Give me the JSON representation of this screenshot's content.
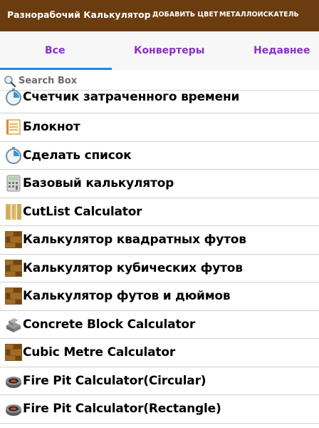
{
  "appbar": {
    "title": "Разнорабочий Калькулятор",
    "actions": [
      "ДОБАВИТЬ ЦВЕТ",
      "МЕТАЛЛОИСКАТЕЛЬ"
    ]
  },
  "tabs": [
    {
      "label": "Все",
      "selected": true
    },
    {
      "label": "Конвертеры",
      "selected": false
    },
    {
      "label": "Недавнее",
      "selected": false
    }
  ],
  "search": {
    "placeholder": "Search Box",
    "icon": "search-icon"
  },
  "items": [
    {
      "label": "Счетчик затраченного времени",
      "icon": "stopwatch-icon"
    },
    {
      "label": "Блокнот",
      "icon": "notepad-icon"
    },
    {
      "label": "Сделать список",
      "icon": "stopwatch-icon"
    },
    {
      "label": "Базовый калькулятор",
      "icon": "calculator-icon"
    },
    {
      "label": "CutList Calculator",
      "icon": "wood-planks-icon"
    },
    {
      "label": "Калькулятор квадратных футов",
      "icon": "wood-floor-icon"
    },
    {
      "label": "Калькулятор кубических футов",
      "icon": "wood-floor-icon"
    },
    {
      "label": "Калькулятор футов и дюймов",
      "icon": "wood-floor-icon"
    },
    {
      "label": "Concrete Block Calculator",
      "icon": "concrete-block-icon"
    },
    {
      "label": "Cubic Metre Calculator",
      "icon": "wood-floor-icon"
    },
    {
      "label": "Fire Pit Calculator(Circular)",
      "icon": "fire-pit-icon"
    },
    {
      "label": "Fire Pit Calculator(Rectangle)",
      "icon": "fire-pit-icon"
    }
  ],
  "colors": {
    "appbar": "#6a3c10",
    "tab_text": "#8b2fc9",
    "tab_indicator": "#1e88e5"
  }
}
